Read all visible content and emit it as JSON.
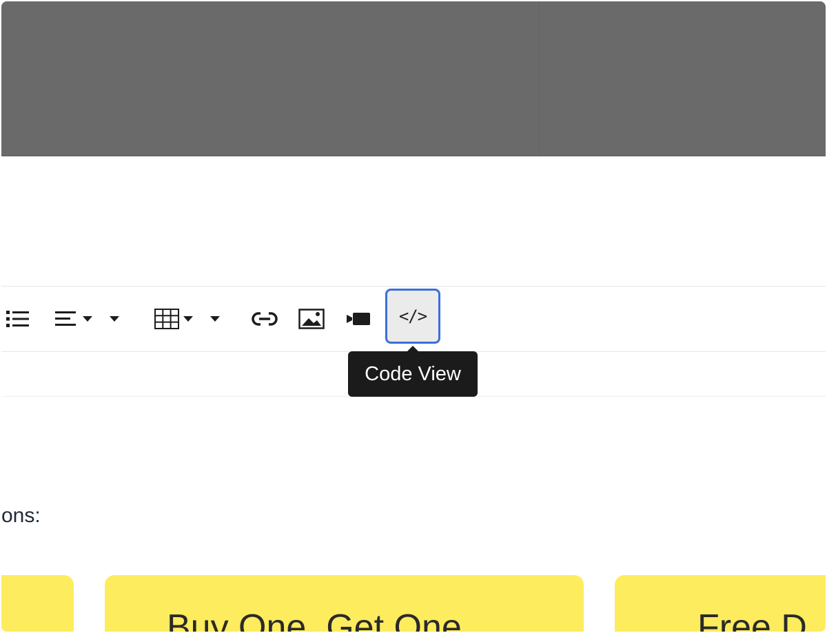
{
  "toolbar": {
    "buttons": [
      {
        "name": "unordered-list",
        "icon": "list-icon"
      },
      {
        "name": "paragraph-align",
        "icon": "align-icon"
      },
      {
        "name": "table",
        "icon": "table-icon"
      },
      {
        "name": "link",
        "icon": "link-icon"
      },
      {
        "name": "picture",
        "icon": "image-icon"
      },
      {
        "name": "video",
        "icon": "video-icon"
      },
      {
        "name": "code-view",
        "icon": "code-icon",
        "glyph": "</>",
        "active": true
      }
    ],
    "accent_color": "#3b6fd8"
  },
  "tooltip": {
    "text": "Code View"
  },
  "content": {
    "intro_fragment": "ons:",
    "cards": [
      {
        "title": ""
      },
      {
        "title": "Buy One, Get One"
      },
      {
        "title": "Free D"
      }
    ],
    "card_color": "#fdec5d"
  }
}
